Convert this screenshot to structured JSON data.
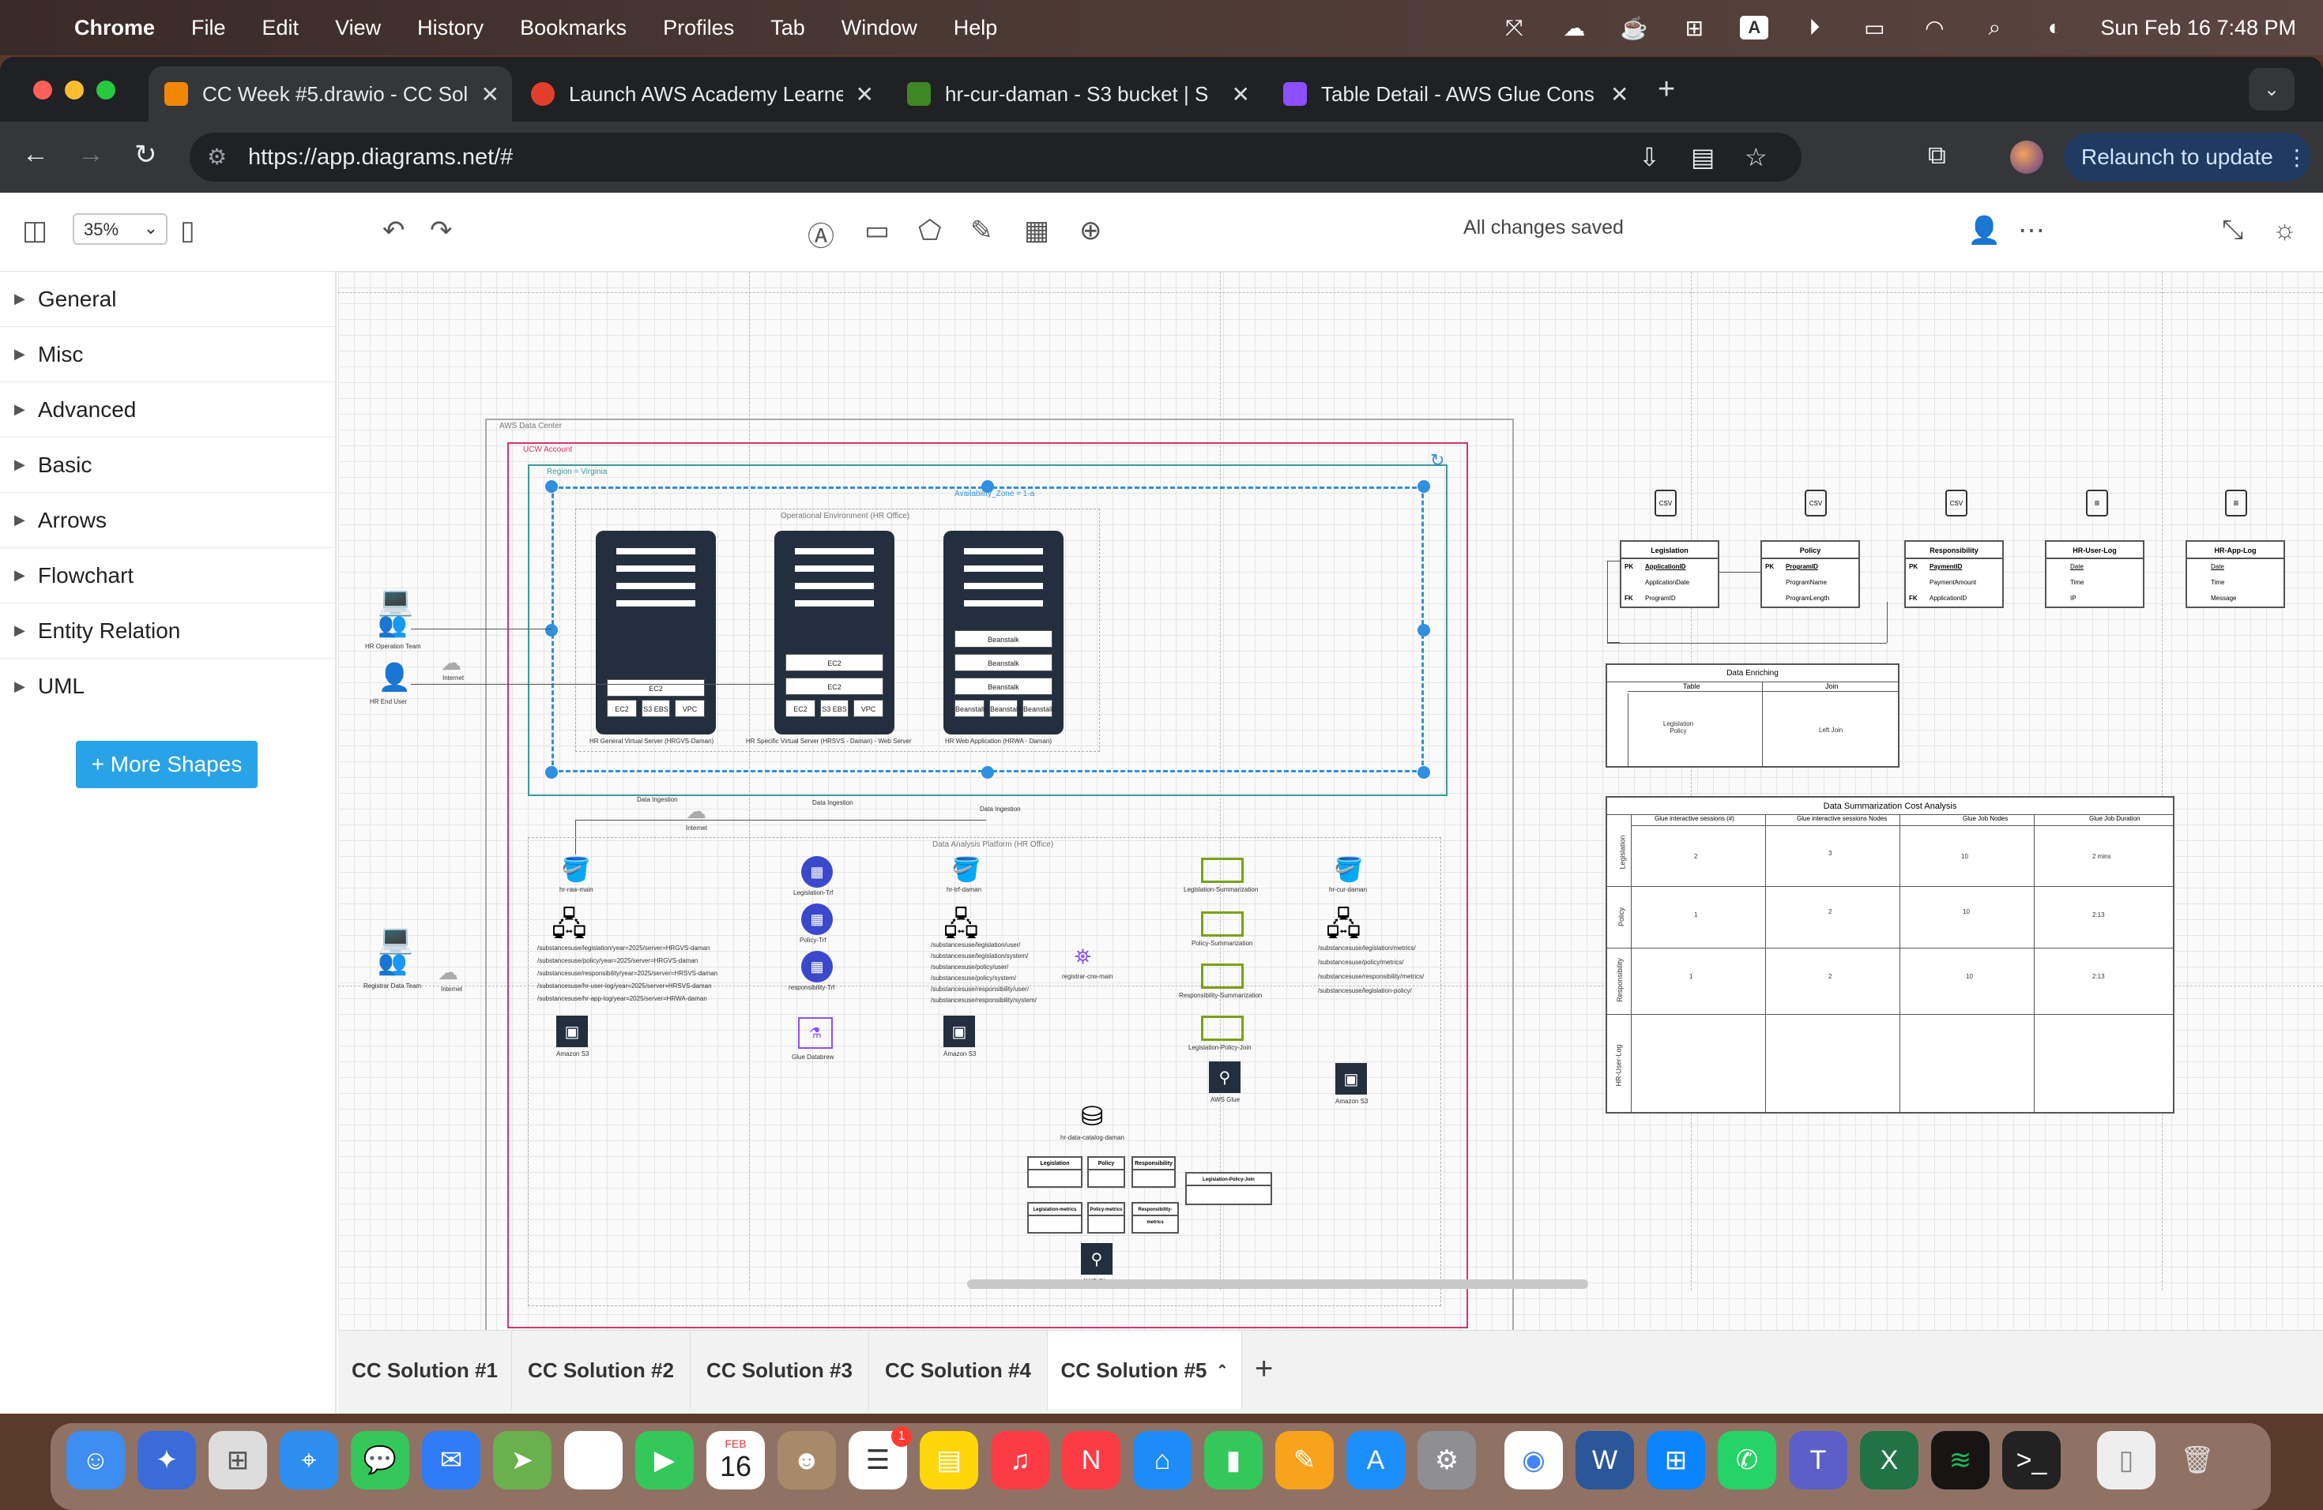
{
  "menubar": {
    "app": "Chrome",
    "items": [
      "File",
      "Edit",
      "View",
      "History",
      "Bookmarks",
      "Profiles",
      "Tab",
      "Window",
      "Help"
    ],
    "datetime": "Sun Feb 16  7:48 PM",
    "keyboard_indicator": "A"
  },
  "tabs": [
    {
      "title": "CC Week #5.drawio - CC Solu",
      "icon": "drawio-icon",
      "color": "#f08705",
      "active": true
    },
    {
      "title": "Launch AWS Academy Learne",
      "icon": "canvas-icon",
      "color": "#e13f2b",
      "active": false
    },
    {
      "title": "hr-cur-daman - S3 bucket | S",
      "icon": "s3-icon",
      "color": "#3f8624",
      "active": false
    },
    {
      "title": "Table Detail - AWS Glue Cons",
      "icon": "glue-icon",
      "color": "#8c4fff",
      "active": false
    }
  ],
  "address": {
    "url": "https://app.diagrams.net/#"
  },
  "relaunch_label": "Relaunch to update",
  "drawio": {
    "zoom": "35%",
    "status": "All changes saved",
    "sidebar": [
      "General",
      "Misc",
      "Advanced",
      "Basic",
      "Arrows",
      "Flowchart",
      "Entity Relation",
      "UML"
    ],
    "more_shapes": "+ More Shapes",
    "pages": [
      "CC Solution #1",
      "CC Solution #2",
      "CC Solution #3",
      "CC Solution #4",
      "CC Solution #5"
    ]
  },
  "diagram": {
    "aws_data_center": "AWS Data Center",
    "ucw_account": "UCW Account",
    "region": "Region = Virginia",
    "availability_zone": "Availability_Zone = 1-a",
    "op_env": "Operational Environment (HR Office)",
    "hr_operation_team": "HR Operation Team",
    "hr_end_user": "HR End User",
    "internet": "Internet",
    "servers": [
      {
        "caption": "HR General Virtual Server (HRGVS-Daman)",
        "slots": [
          "EC2",
          "EC2",
          "S3 EBS",
          "VPC"
        ]
      },
      {
        "caption": "HR Specific Virtual Server (HRSVS - Daman) - Web Server",
        "slots": [
          "EC2",
          "EC2",
          "EC2",
          "S3 EBS",
          "VPC"
        ]
      },
      {
        "caption": "HR Web Application (HRWA - Daman)",
        "slots": [
          "Beanstalk",
          "Beanstalk",
          "Beanstalk",
          "Beanstalk",
          "Beanstalk",
          "Beanstalk"
        ]
      }
    ],
    "data_ingestion": "Data Ingestion",
    "analysis_platform": "Data Analysis Platform (HR Office)",
    "registrar_team": "Registrar Data Team",
    "buckets": {
      "raw": "hr-raw-main",
      "trf": "hr-trf-daman",
      "cur": "hr-cur-daman"
    },
    "raw_paths": [
      "/substancesuse/legislation/year=2025/server=HRGVS-daman",
      "/substancesuse/policy/year=2025/server=HRGVS-daman",
      "/substancesuse/responsibility/year=2025/server=HRSVS-daman",
      "/substancesuse/hr-user-log/year=2025/server=HRSVS-daman",
      "/substancesuse/hr-app-log/year=2025/server=HRWA-daman"
    ],
    "trf_paths": [
      "/substancesuse/legislation/user/",
      "/substancesuse/legislation/system/",
      "/substancesuse/policy/user/",
      "/substancesuse/policy/system/",
      "/substancesuse/responsibility/user/",
      "/substancesuse/responsibility/system/"
    ],
    "cur_paths": [
      "/substancesuse/legislation/metrics/",
      "/substancesuse/policy/metrics/",
      "/substancesuse/responsibility/metrics/",
      "/substancesuse/legislation-policy/"
    ],
    "jobs": [
      "Legislation-Trf",
      "Policy-Trf",
      "responsibility-Trf"
    ],
    "summaries": [
      "Legislation-Summarization",
      "Policy-Summarization",
      "Responsibility-Summarization",
      "Legislation-Policy-Join"
    ],
    "crawler": "registrar-crw-main",
    "glue_databrew": "Glue Databrew",
    "amazon_s3": "Amazon S3",
    "aws_glue": "AWS Glue",
    "catalog": "hr-data-catalog-daman",
    "catalog_tables": [
      "Legislation",
      "Policy",
      "Responsibility",
      "Legislation-metrics",
      "Policy-metrics",
      "Responsibility-metrics",
      "Legislation-Policy-Join"
    ],
    "er_tables": [
      {
        "name": "Legislation",
        "rows": [
          [
            "PK",
            "ApplicationID"
          ],
          [
            "",
            "ApplicationDate"
          ],
          [
            "FK",
            "ProgramID"
          ]
        ]
      },
      {
        "name": "Policy",
        "rows": [
          [
            "PK",
            "ProgramID"
          ],
          [
            "",
            "ProgramName"
          ],
          [
            "",
            "ProgramLength"
          ]
        ]
      },
      {
        "name": "Responsibility",
        "rows": [
          [
            "PK",
            "PaymentID"
          ],
          [
            "",
            "PaymentAmount"
          ],
          [
            "FK",
            "ApplicationID"
          ]
        ]
      },
      {
        "name": "HR-User-Log",
        "rows": [
          [
            "",
            "Date"
          ],
          [
            "",
            "Time"
          ],
          [
            "",
            "IP"
          ]
        ]
      },
      {
        "name": "HR-App-Log",
        "rows": [
          [
            "",
            "Date"
          ],
          [
            "",
            "Time"
          ],
          [
            "",
            "Message"
          ]
        ]
      }
    ],
    "enriching": {
      "title": "Data Enriching",
      "headers": [
        "Table",
        "Join"
      ],
      "row": [
        "Legislation Policy",
        "Left Join"
      ]
    },
    "cost": {
      "title": "Data Summarization Cost Analysis",
      "headers": [
        "Glue interactive sessions (#)",
        "Glue interactive sessions Nodes",
        "Glue Job Nodes",
        "Glue Job Duration"
      ],
      "rows": [
        {
          "name": "Legislation",
          "values": [
            "2",
            "3",
            "10",
            "2 mins"
          ]
        },
        {
          "name": "Policy",
          "values": [
            "1",
            "2",
            "10",
            "2:13"
          ]
        },
        {
          "name": "Responsibility",
          "values": [
            "1",
            "2",
            "10",
            "2:13"
          ]
        },
        {
          "name": "HR-User-Log",
          "values": [
            "",
            "",
            "",
            ""
          ]
        }
      ]
    },
    "csv": "CSV"
  },
  "dock": {
    "calendar_month": "FEB",
    "calendar_day": "16",
    "reminders_badge": "1"
  }
}
